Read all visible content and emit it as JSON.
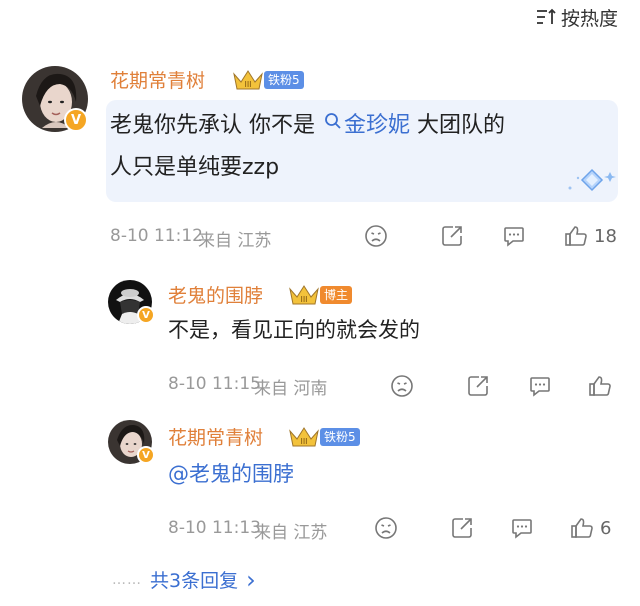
{
  "sort": {
    "label": "按热度",
    "icon": "sort-icon"
  },
  "comments": [
    {
      "user": "花期常青树",
      "badge": "铁粉5",
      "text_a": "老鬼你先承认 你不是",
      "topic": "金珍妮",
      "text_b": " 大团队的",
      "text_line2": "人只是单纯要zzp",
      "time": "8-10 11:12",
      "location": "来自 江苏",
      "like_count": "18"
    }
  ],
  "replies": [
    {
      "user": "老鬼的围脖",
      "badge": "博主",
      "text": "不是，看见正向的就会发的",
      "time": "8-10 11:15",
      "location": "来自 河南",
      "like_count": ""
    },
    {
      "user": "花期常青树",
      "badge": "铁粉5",
      "mention": "@老鬼的围脖",
      "time": "8-10 11:13",
      "location": "来自 江苏",
      "like_count": "6"
    }
  ],
  "more_replies": {
    "dots": "……",
    "label": "共3条回复",
    "chevron": "›"
  },
  "colors": {
    "username": "#e0803a",
    "link": "#3b6fd1",
    "fan_badge": "#5c8fe6",
    "host_badge": "#f08a2e",
    "bubble": "#eef3fc"
  },
  "icons": [
    "sort-icon",
    "dislike-icon",
    "share-icon",
    "comment-icon",
    "like-icon",
    "crown-icon",
    "v-badge-icon",
    "search-icon"
  ]
}
